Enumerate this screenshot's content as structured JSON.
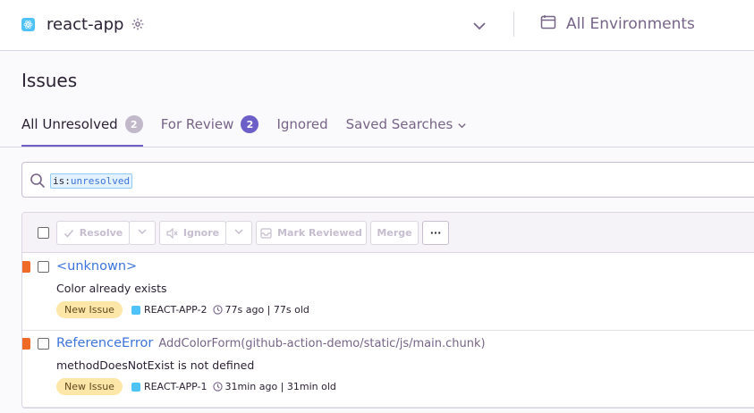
{
  "header": {
    "project_name": "react-app",
    "environment_label": "All Environments"
  },
  "page": {
    "title": "Issues"
  },
  "tabs": [
    {
      "label": "All Unresolved",
      "count": "2"
    },
    {
      "label": "For Review",
      "count": "2"
    },
    {
      "label": "Ignored"
    },
    {
      "label": "Saved Searches"
    }
  ],
  "search": {
    "token_key": "is:",
    "token_value": "unresolved"
  },
  "toolbar": {
    "resolve_label": "Resolve",
    "ignore_label": "Ignore",
    "mark_reviewed_label": "Mark Reviewed",
    "merge_label": "Merge",
    "more_label": "···"
  },
  "issues": [
    {
      "title": "<unknown>",
      "culprit": "",
      "message": "Color already exists",
      "badge": "New Issue",
      "short_id": "REACT-APP-2",
      "time": "77s ago | 77s old"
    },
    {
      "title": "ReferenceError",
      "culprit": "AddColorForm(github-action-demo/static/js/main.chunk)",
      "message": "methodDoesNotExist is not defined",
      "badge": "New Issue",
      "short_id": "REACT-APP-1",
      "time": "31min ago | 31min old"
    }
  ],
  "colors": {
    "accent": "#6c5fc7",
    "link": "#3d74db",
    "level_error": "#f06a27",
    "new_badge": "#fde7a8"
  }
}
